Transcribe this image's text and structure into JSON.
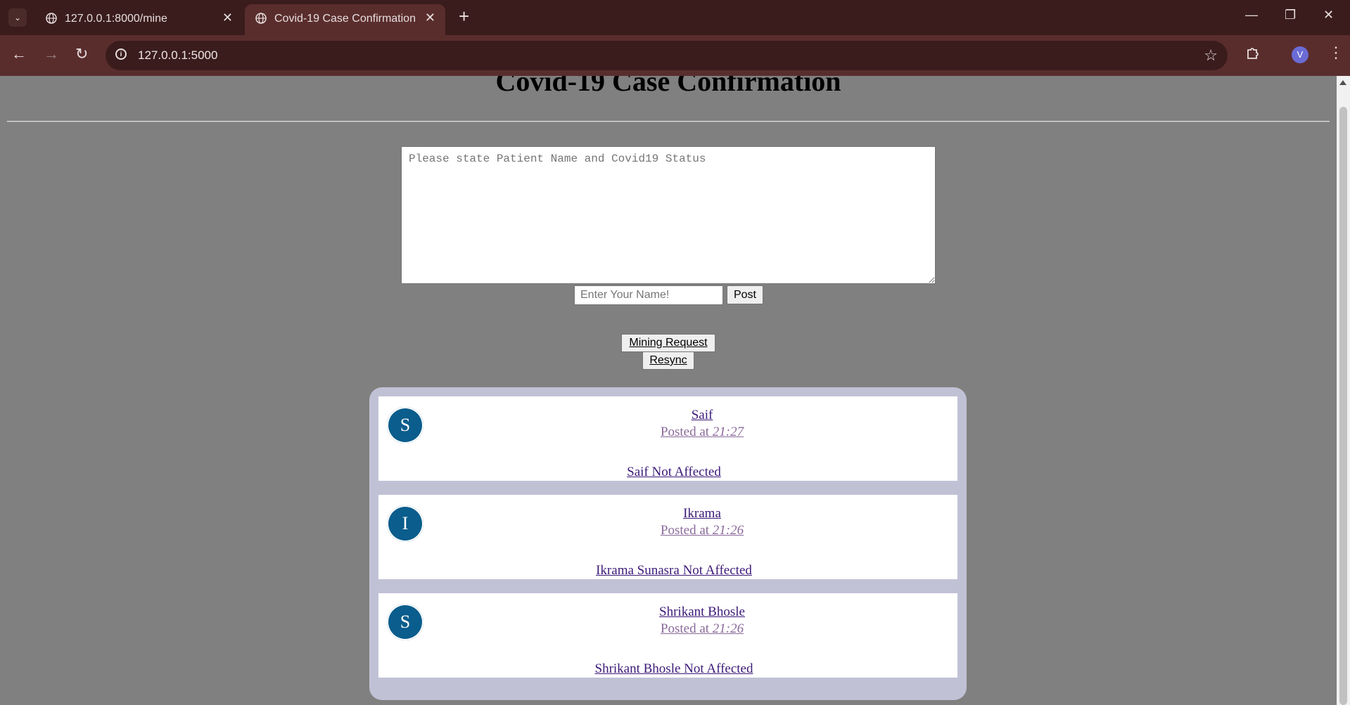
{
  "browser": {
    "tabs": [
      {
        "title": "127.0.0.1:8000/mine",
        "active": false
      },
      {
        "title": "Covid-19 Case Confirmation",
        "active": true
      }
    ],
    "url": "127.0.0.1:5000",
    "profile_initial": "V"
  },
  "page": {
    "heading": "Covid-19 Case Confirmation",
    "textarea_placeholder": "Please state Patient Name and Covid19 Status",
    "name_placeholder": "Enter Your Name!",
    "post_label": "Post",
    "mining_label": "Mining Request",
    "resync_label": "Resync"
  },
  "posts": [
    {
      "initial": "S",
      "author": "Saif",
      "posted_prefix": "Posted at ",
      "time": "21:27",
      "content": "Saif Not Affected"
    },
    {
      "initial": "I",
      "author": "Ikrama",
      "posted_prefix": "Posted at ",
      "time": "21:26",
      "content": "Ikrama Sunasra Not Affected"
    },
    {
      "initial": "S",
      "author": "Shrikant Bhosle",
      "posted_prefix": "Posted at ",
      "time": "21:26",
      "content": "Shrikant Bhosle Not Affected"
    }
  ],
  "colors": {
    "page_bg": "#808080",
    "feed_bg": "#c1c1d6",
    "avatar_bg": "#0a5d8c",
    "link_color": "#3c1a78"
  }
}
